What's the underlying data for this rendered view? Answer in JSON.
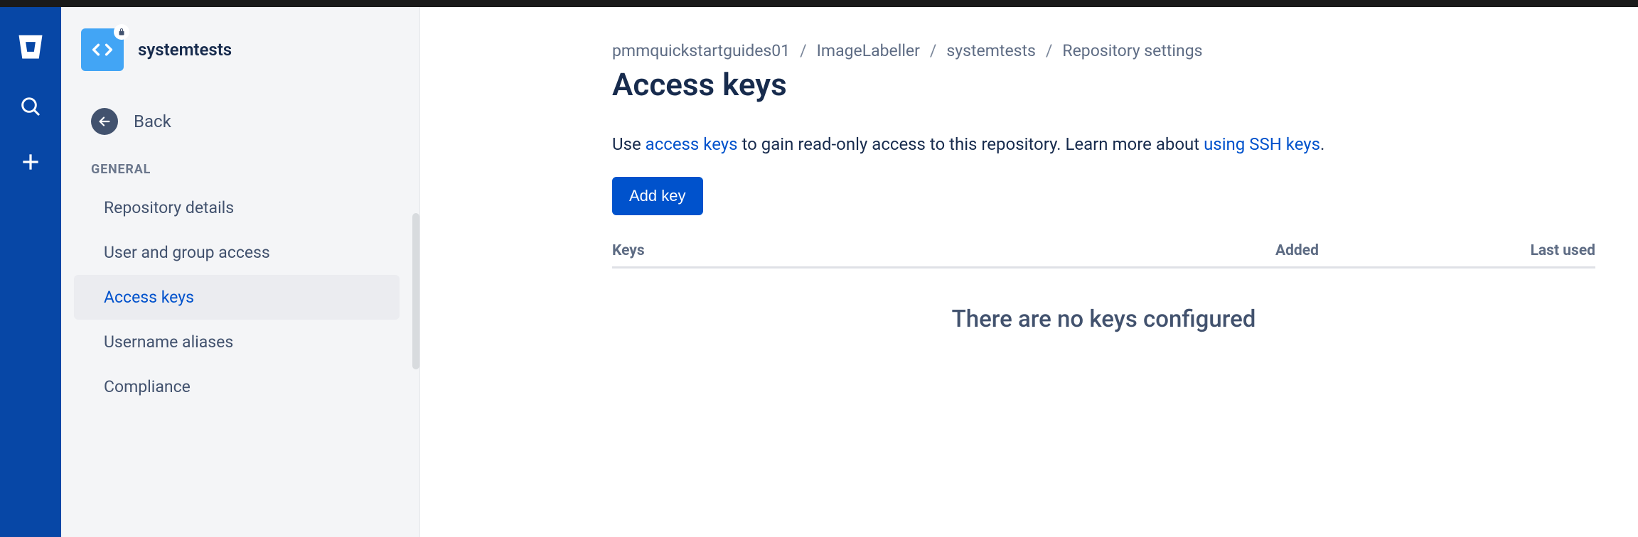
{
  "repo": {
    "name": "systemtests"
  },
  "sidebar": {
    "back_label": "Back",
    "section_title": "GENERAL",
    "items": [
      {
        "label": "Repository details",
        "active": false
      },
      {
        "label": "User and group access",
        "active": false
      },
      {
        "label": "Access keys",
        "active": true
      },
      {
        "label": "Username aliases",
        "active": false
      },
      {
        "label": "Compliance",
        "active": false
      }
    ]
  },
  "breadcrumb": [
    "pmmquickstartguides01",
    "ImageLabeller",
    "systemtests",
    "Repository settings"
  ],
  "page": {
    "title": "Access keys",
    "desc_pre": "Use ",
    "desc_link1": "access keys",
    "desc_mid": " to gain read-only access to this repository. Learn more about ",
    "desc_link2": "using SSH keys",
    "desc_post": ".",
    "add_key_label": "Add key"
  },
  "table": {
    "headers": {
      "keys": "Keys",
      "added": "Added",
      "last_used": "Last used"
    },
    "empty_message": "There are no keys configured"
  }
}
